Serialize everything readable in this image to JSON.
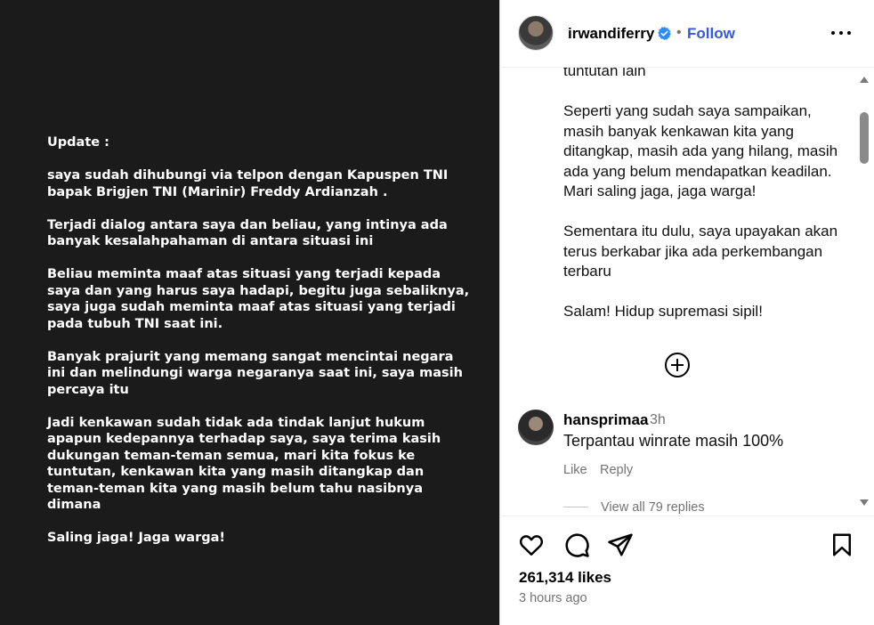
{
  "post_image": {
    "paragraphs": [
      "Update :",
      "saya sudah dihubungi via telpon dengan Kapuspen TNI bapak Brigjen TNI (Marinir) Freddy Ardianzah .",
      "Terjadi dialog antara saya dan beliau, yang intinya ada banyak kesalahpahaman di antara situasi ini",
      "Beliau meminta maaf atas situasi yang terjadi kepada saya dan yang harus saya hadapi, begitu juga sebaliknya, saya juga sudah meminta maaf atas situasi yang terjadi pada tubuh TNI saat ini.",
      "Banyak prajurit yang memang sangat mencintai negara ini dan melindungi warga negaranya saat ini, saya masih percaya itu",
      "Jadi kenkawan sudah tidak ada tindak lanjut hukum apapun kedepannya terhadap saya, saya terima kasih dukungan teman-teman semua, mari kita fokus ke tuntutan, kenkawan kita yang masih ditangkap dan teman-teman kita yang masih belum tahu nasibnya dimana",
      "Saling jaga! Jaga warga!"
    ]
  },
  "header": {
    "username": "irwandiferry",
    "separator": "•",
    "follow_label": "Follow",
    "verified_icon": "verified-badge-icon",
    "more_icon": "more-options-icon"
  },
  "caption": {
    "paragraphs": [
      "tuntutan lain",
      "Seperti yang sudah saya sampaikan, masih banyak kenkawan kita yang ditangkap, masih ada yang hilang, masih ada yang belum mendapatkan keadilan. Mari saling jaga, jaga warga!",
      "Sementara itu dulu, saya upayakan akan terus berkabar jika ada perkembangan terbaru",
      "Salam! Hidup supremasi sipil!"
    ]
  },
  "comment": {
    "username": "hansprimaa",
    "time": "3h",
    "text": "Terpantau winrate masih 100%",
    "like_label": "Like",
    "reply_label": "Reply",
    "view_replies": "View all 79 replies"
  },
  "footer": {
    "likes": "261,314 likes",
    "time_ago": "3 hours ago",
    "icons": [
      "heart-icon",
      "comment-icon",
      "share-icon",
      "bookmark-icon"
    ]
  },
  "colors": {
    "accent": "#3556e6",
    "verified": "#2f8bf5",
    "post_bg": "#1b1b1b"
  }
}
